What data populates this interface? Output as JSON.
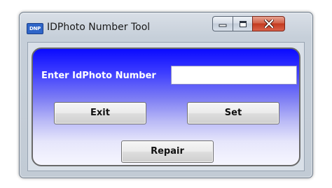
{
  "window": {
    "title": "IDPhoto Number Tool",
    "app_icon_text": "DNP",
    "app_icon_name": "app-icon",
    "caption_buttons": {
      "minimize_icon": "minimize-icon",
      "maximize_icon": "maximize-icon",
      "close_icon": "close-icon"
    }
  },
  "form": {
    "id_label": "Enter IdPhoto Number",
    "id_value": "",
    "exit_label": "Exit",
    "set_label": "Set",
    "repair_label": "Repair"
  },
  "colors": {
    "panel_top": "#0a0aff",
    "panel_bottom": "#f6f6ff",
    "close_button": "#c33a1f"
  }
}
